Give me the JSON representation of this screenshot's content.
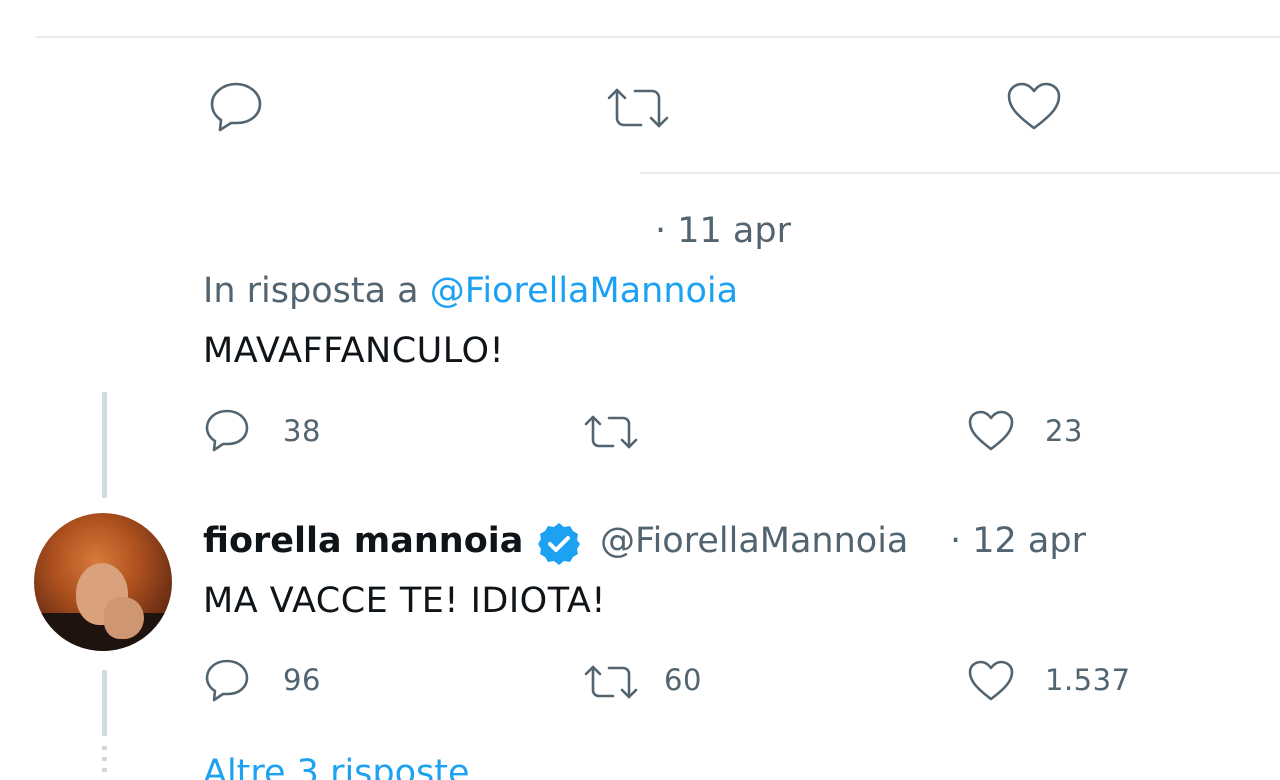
{
  "tweet_top": {
    "actions": {
      "reply_icon": "reply-icon",
      "retweet_icon": "retweet-icon",
      "like_icon": "like-icon"
    }
  },
  "reply_tweet": {
    "date_meta": "· 11 apr",
    "reply_prefix": "In risposta a",
    "reply_to_handle": "@FiorellaMannoia",
    "body": "MAVAFFANCULO!",
    "reply_count": "38",
    "retweet_count": "",
    "like_count": "23"
  },
  "main_tweet": {
    "display_name": "fiorella mannoia",
    "handle": "@FiorellaMannoia",
    "date_meta": "· 12 apr",
    "body": "MA VACCE TE! IDIOTA!",
    "reply_count": "96",
    "retweet_count": "60",
    "like_count": "1.537",
    "verified_icon": "verified-badge-icon"
  },
  "more_replies": {
    "label": "Altre 3 risposte"
  },
  "colors": {
    "link": "#1da1f2",
    "meta": "#536471",
    "text": "#0f1419",
    "divider": "#e6ecf0"
  }
}
